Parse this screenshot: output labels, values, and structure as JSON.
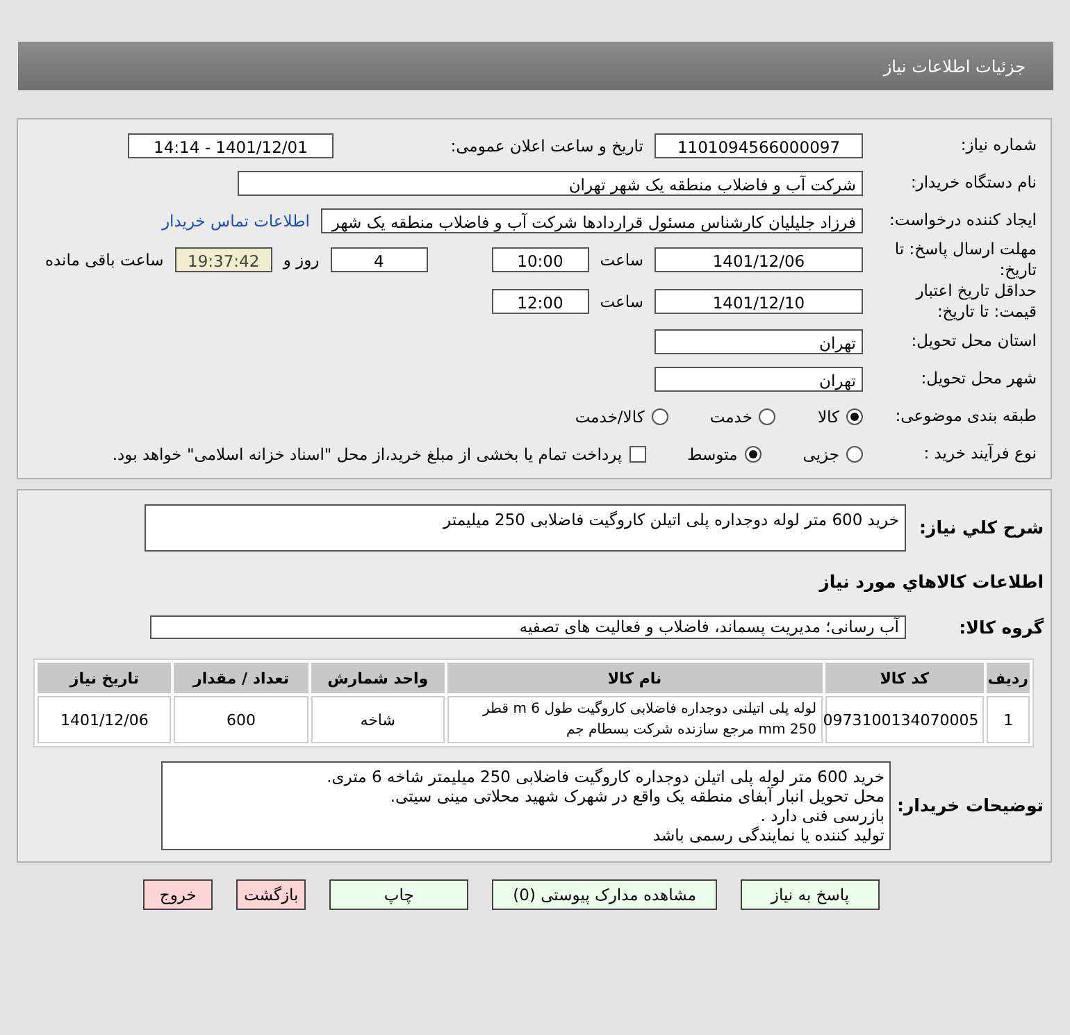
{
  "header": {
    "title": "جزئیات اطلاعات نیاز"
  },
  "need_number": {
    "label": "شماره نیاز:",
    "value": "1101094566000097"
  },
  "announce": {
    "label": "تاریخ و ساعت اعلان عمومی:",
    "value": "1401/12/01 - 14:14"
  },
  "buyer": {
    "label": "نام دستگاه خریدار:",
    "value": "شرکت آب و فاضلاب منطقه یک شهر تهران"
  },
  "requester": {
    "label": "ایجاد کننده درخواست:",
    "value": "فرزاد جلیلیان کارشناس مسئول قراردادها شرکت آب و فاضلاب منطقه یک شهر",
    "link": "اطلاعات تماس خریدار"
  },
  "deadline": {
    "label": "مهلت ارسال پاسخ: تا تاریخ:",
    "date": "1401/12/06",
    "time_label": "ساعت",
    "time": "10:00",
    "days": "4",
    "days_label": "روز و",
    "remaining": "19:37:42",
    "remaining_label": "ساعت باقی مانده"
  },
  "validity": {
    "label": "حداقل تاریخ اعتبار قیمت: تا تاریخ:",
    "date": "1401/12/10",
    "time_label": "ساعت",
    "time": "12:00"
  },
  "province": {
    "label": "استان محل تحویل:",
    "value": "تهران"
  },
  "city": {
    "label": "شهر محل تحویل:",
    "value": "تهران"
  },
  "category": {
    "label": "طبقه بندی موضوعی:",
    "options": [
      {
        "label": "کالا",
        "selected": true
      },
      {
        "label": "خدمت",
        "selected": false
      },
      {
        "label": "کالا/خدمت",
        "selected": false
      }
    ]
  },
  "process": {
    "label": "نوع فرآیند خرید :",
    "options": [
      {
        "label": "جزیی",
        "selected": false
      },
      {
        "label": "متوسط",
        "selected": true
      }
    ],
    "payment": {
      "label": "پرداخت تمام یا بخشی از مبلغ خرید،از محل \"اسناد خزانه اسلامی\" خواهد بود.",
      "checked": false
    }
  },
  "summary": {
    "label": "شرح کلي نياز:",
    "value": "خرید 600 متر لوله دوجداره پلی اتیلن کاروگیت فاضلابی 250 میلیمتر"
  },
  "goods_title": "اطلاعات كالاهاي مورد نياز",
  "goods_group": {
    "label": "گروه کالا:",
    "value": "آب رسانی؛ مدیریت پسماند، فاضلاب و فعالیت های تصفیه"
  },
  "table": {
    "columns": [
      "ردیف",
      "کد کالا",
      "نام کالا",
      "واحد شمارش",
      "تعداد / مقدار",
      "تاریخ نیاز"
    ],
    "rows": [
      [
        "1",
        "0973100134070005",
        "لوله پلی اتیلنی دوجداره فاضلابی کاروگیت طول 6 m قطر 250 mm مرجع سازنده شرکت بسطام جم",
        "شاخه",
        "600",
        "1401/12/06"
      ]
    ]
  },
  "notes": {
    "label": "توضیحات خریدار:",
    "lines": [
      "خرید 600 متر لوله پلی اتیلن دوجداره کاروگیت فاضلابی 250 میلیمتر شاخه 6 متری.",
      "محل تحویل انبار آبفای منطقه یک واقع در شهرک شهید محلاتی مینی سیتی.",
      "بازرسی فنی دارد .",
      "تولید کننده یا نمایندگی رسمی باشد"
    ]
  },
  "buttons": [
    {
      "label": "پاسخ به نیاز",
      "kind": "green"
    },
    {
      "label": "مشاهده مدارک پیوستی (0)",
      "kind": "green"
    },
    {
      "label": "چاپ",
      "kind": "green"
    },
    {
      "label": "بازگشت",
      "kind": "red"
    },
    {
      "label": "خروج",
      "kind": "red"
    }
  ]
}
